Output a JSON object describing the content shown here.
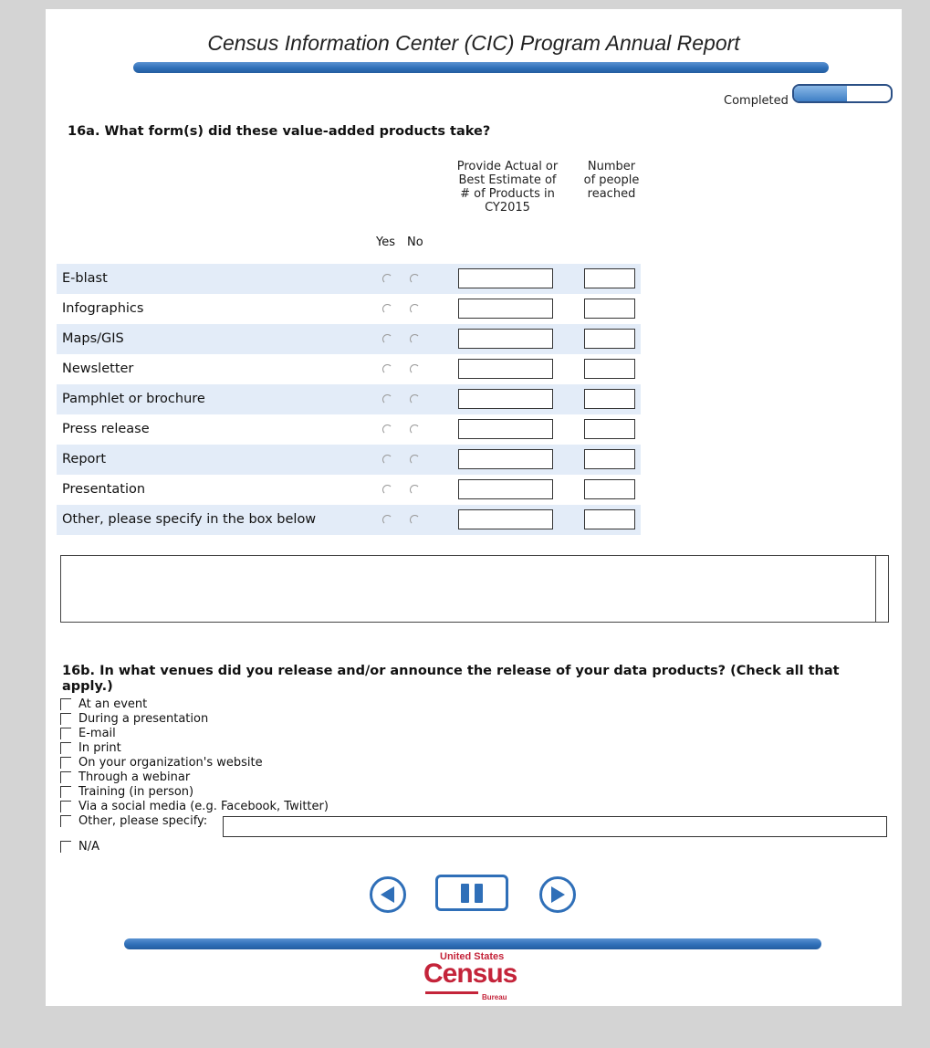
{
  "header": {
    "title": "Census Information Center (CIC) Program Annual Report"
  },
  "progress": {
    "label": "Completed",
    "fraction": 0.55
  },
  "q16a": {
    "question": "16a. What form(s) did these value-added products take?",
    "columns": {
      "actual": "Provide Actual or Best Estimate of # of Products in CY2015",
      "reached": "Number of people reached",
      "yes": "Yes",
      "no": "No"
    },
    "rows": [
      {
        "label": "E-blast"
      },
      {
        "label": "Infographics"
      },
      {
        "label": "Maps/GIS"
      },
      {
        "label": "Newsletter"
      },
      {
        "label": "Pamphlet or brochure"
      },
      {
        "label": "Press release"
      },
      {
        "label": "Report"
      },
      {
        "label": "Presentation"
      },
      {
        "label": "Other, please specify in the box below"
      }
    ]
  },
  "q16b": {
    "question": "16b. In what venues did you release and/or announce the release of your data products? (Check all that apply.)",
    "options": [
      "At an event",
      "During a presentation",
      "E-mail",
      "In print",
      "On your organization's website",
      "Through a webinar",
      "Training (in person)",
      "Via a social media (e.g. Facebook, Twitter)",
      "Other, please specify:",
      "N/A"
    ]
  },
  "nav": {
    "prev_icon": "arrow-left-circle",
    "pause_icon": "pause",
    "next_icon": "arrow-right-circle"
  },
  "logo": {
    "top": "United States",
    "main": "Census",
    "sub": "Bureau"
  },
  "colors": {
    "accent_blue": "#2f6fb8",
    "row_shade": "#e3ecf8",
    "logo_red": "#c4243a"
  }
}
